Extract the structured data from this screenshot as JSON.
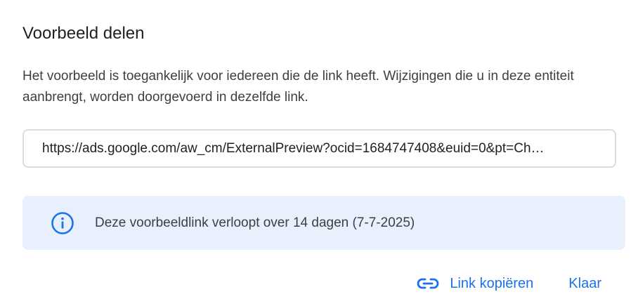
{
  "dialog": {
    "title": "Voorbeeld delen",
    "description": "Het voorbeeld is toegankelijk voor iedereen die de link heeft. Wijzigingen die u in deze entiteit aanbrengt, worden doorgevoerd in dezelfde link.",
    "url_value": "https://ads.google.com/aw_cm/ExternalPreview?ocid=1684747408&euid=0&pt=Ch…",
    "notice": {
      "icon": "info-icon",
      "text": "Deze voorbeeldlink verloopt over 14 dagen (7-7-2025)"
    },
    "buttons": {
      "copy_link_label": "Link kopiëren",
      "copy_link_icon": "link-icon",
      "done_label": "Klaar"
    }
  },
  "colors": {
    "accent": "#1a73e8",
    "notice_background": "#e8f0fe",
    "field_border": "#dadce0",
    "title_text": "#202124",
    "body_text": "#3c4043"
  }
}
